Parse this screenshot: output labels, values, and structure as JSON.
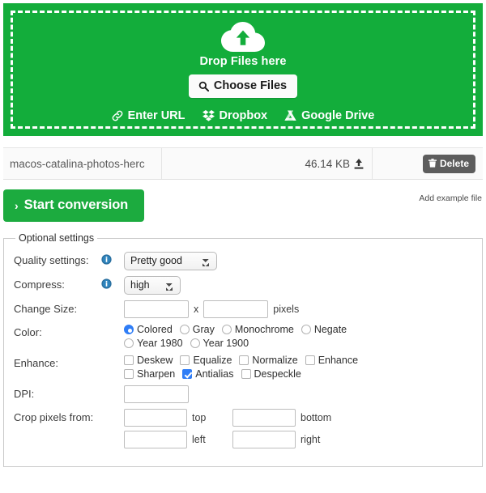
{
  "dropzone": {
    "icon": "cloud-upload-icon",
    "title": "Drop Files here",
    "choose_button": "Choose Files",
    "choose_icon": "search-icon",
    "services": [
      {
        "label": "Enter URL",
        "icon": "link-icon"
      },
      {
        "label": "Dropbox",
        "icon": "dropbox-icon"
      },
      {
        "label": "Google Drive",
        "icon": "google-drive-icon"
      }
    ],
    "accent_color": "#13ad3b"
  },
  "file_row": {
    "name": "macos-catalina-photos-herc",
    "size": "46.14 KB",
    "size_icon": "upload-arrow-icon",
    "delete_label": "Delete",
    "delete_icon": "trash-icon"
  },
  "actions": {
    "start_label": "Start conversion",
    "start_chevron": "›",
    "example_link": "Add example file",
    "start_color": "#1cab3f"
  },
  "settings": {
    "legend": "Optional settings",
    "quality": {
      "label": "Quality settings:",
      "info_icon": "info-icon",
      "value": "Pretty good",
      "options": [
        "Pretty good"
      ]
    },
    "compress": {
      "label": "Compress:",
      "info_icon": "info-icon",
      "value": "high",
      "options": [
        "high"
      ]
    },
    "change_size": {
      "label": "Change Size:",
      "width_value": "",
      "height_value": "",
      "separator": "x",
      "unit": "pixels"
    },
    "color": {
      "label": "Color:",
      "selected": "Colored",
      "options": [
        "Colored",
        "Gray",
        "Monochrome",
        "Negate",
        "Year 1980",
        "Year 1900"
      ]
    },
    "enhance": {
      "label": "Enhance:",
      "options": [
        {
          "label": "Deskew",
          "checked": false
        },
        {
          "label": "Equalize",
          "checked": false
        },
        {
          "label": "Normalize",
          "checked": false
        },
        {
          "label": "Enhance",
          "checked": false
        },
        {
          "label": "Sharpen",
          "checked": false
        },
        {
          "label": "Antialias",
          "checked": true
        },
        {
          "label": "Despeckle",
          "checked": false
        }
      ]
    },
    "dpi": {
      "label": "DPI:",
      "value": ""
    },
    "crop": {
      "label": "Crop pixels from:",
      "top_value": "",
      "top_label": "top",
      "bottom_value": "",
      "bottom_label": "bottom",
      "left_value": "",
      "left_label": "left",
      "right_value": "",
      "right_label": "right"
    }
  }
}
